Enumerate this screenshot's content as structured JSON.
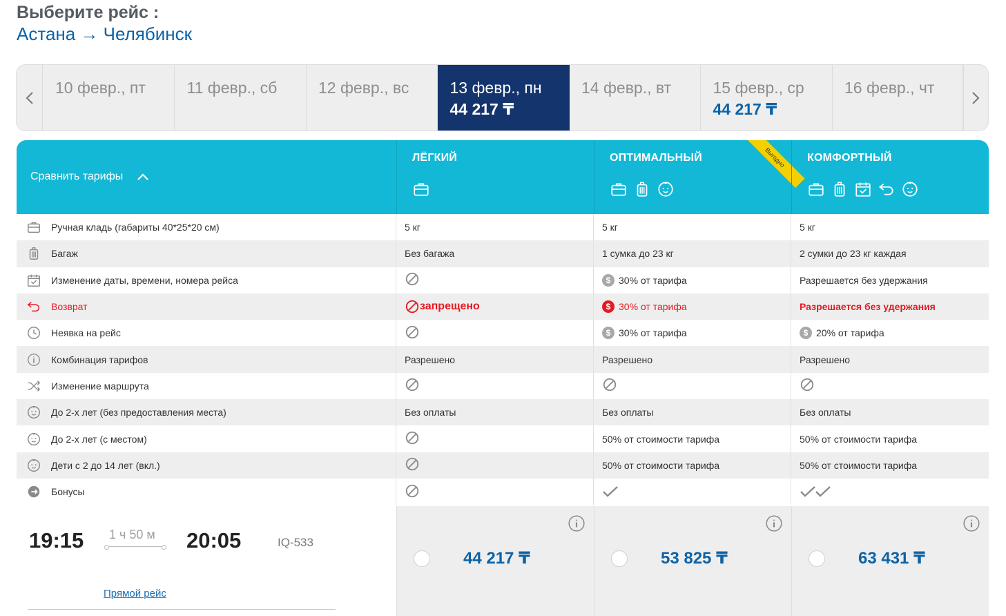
{
  "heading": {
    "title": "Выберите рейс :",
    "route": "Астана →  Челябинск"
  },
  "dates": [
    {
      "label": "10 февр., пт",
      "price": ""
    },
    {
      "label": "11 февр., сб",
      "price": ""
    },
    {
      "label": "12 февр., вс",
      "price": ""
    },
    {
      "label": "13 февр., пн",
      "price": "44 217 ₸",
      "active": true
    },
    {
      "label": "14 февр., вт",
      "price": ""
    },
    {
      "label": "15 февр., ср",
      "price": "44 217 ₸"
    },
    {
      "label": "16 февр., чт",
      "price": ""
    }
  ],
  "compare": {
    "toggle_label": "Сравнить тарифы",
    "fares": [
      {
        "name": "ЛЁГКИЙ",
        "icons": [
          "briefcase-icon"
        ]
      },
      {
        "name": "ОПТИМАЛЬНЫЙ",
        "icons": [
          "briefcase-icon",
          "luggage-icon",
          "baby-icon"
        ],
        "badge": "Выгодно"
      },
      {
        "name": "КОМФОРТНЫЙ",
        "icons": [
          "briefcase-icon",
          "luggage-icon",
          "calendar-icon",
          "return-icon",
          "baby-icon"
        ]
      }
    ],
    "rows": [
      {
        "icon": "briefcase-icon",
        "name": "Ручная кладь (габариты 40*25*20 см)",
        "values": [
          {
            "t": "5 кг"
          },
          {
            "t": "5 кг"
          },
          {
            "t": "5 кг"
          }
        ]
      },
      {
        "icon": "luggage-icon",
        "name": "Багаж",
        "values": [
          {
            "t": "Без багажа"
          },
          {
            "t": "1 сумка до 23 кг"
          },
          {
            "t": "2 сумки до 23 кг каждая"
          }
        ]
      },
      {
        "icon": "calendar-icon",
        "name": "Изменение даты, времени, номера рейса",
        "values": [
          {
            "k": "no"
          },
          {
            "k": "fee",
            "t": "30% от тарифа"
          },
          {
            "t": "Разрешается без удержания"
          }
        ]
      },
      {
        "icon": "return-icon",
        "name": "Возврат",
        "red": true,
        "values": [
          {
            "k": "no-red",
            "t": "запрещено"
          },
          {
            "k": "fee-red",
            "t": "30% от тарифа"
          },
          {
            "k": "red",
            "t": "Разрешается без удержания"
          }
        ]
      },
      {
        "icon": "clock-icon",
        "name": "Неявка на рейс",
        "values": [
          {
            "k": "no"
          },
          {
            "k": "fee",
            "t": "30% от тарифа"
          },
          {
            "k": "fee",
            "t": "20% от тарифа"
          }
        ]
      },
      {
        "icon": "info-icon",
        "name": "Комбинация тарифов",
        "values": [
          {
            "t": "Разрешено"
          },
          {
            "t": "Разрешено"
          },
          {
            "t": "Разрешено"
          }
        ]
      },
      {
        "icon": "shuffle-icon",
        "name": "Изменение маршрута",
        "values": [
          {
            "k": "no"
          },
          {
            "k": "no"
          },
          {
            "k": "no"
          }
        ]
      },
      {
        "icon": "baby-icon",
        "name": "До 2-х лет (без предоставления места)",
        "values": [
          {
            "t": "Без оплаты"
          },
          {
            "t": "Без оплаты"
          },
          {
            "t": "Без оплаты"
          }
        ]
      },
      {
        "icon": "baby-icon",
        "name": "До 2-х лет (с местом)",
        "values": [
          {
            "k": "no"
          },
          {
            "t": "50% от стоимости тарифа"
          },
          {
            "t": "50% от стоимости тарифа"
          }
        ]
      },
      {
        "icon": "baby-icon",
        "name": "Дети с 2 до 14 лет (вкл.)",
        "values": [
          {
            "k": "no"
          },
          {
            "t": "50% от стоимости тарифа"
          },
          {
            "t": "50% от стоимости тарифа"
          }
        ]
      },
      {
        "icon": "bonus-icon",
        "name": "Бонусы",
        "values": [
          {
            "k": "no"
          },
          {
            "k": "check"
          },
          {
            "k": "double-check"
          }
        ]
      }
    ]
  },
  "flight": {
    "departure": "19:15",
    "duration": "1 ч 50 м",
    "arrival": "20:05",
    "number": "IQ-533",
    "direct_label": "Прямой рейс",
    "prices": [
      "44 217 ₸",
      "53 825 ₸",
      "63 431 ₸"
    ]
  },
  "colors": {
    "brand_blue": "#0c63a6",
    "header_cyan": "#13b8d6",
    "active_date": "#14346e",
    "alert_red": "#e31b23",
    "badge_yellow": "#f5d000"
  }
}
